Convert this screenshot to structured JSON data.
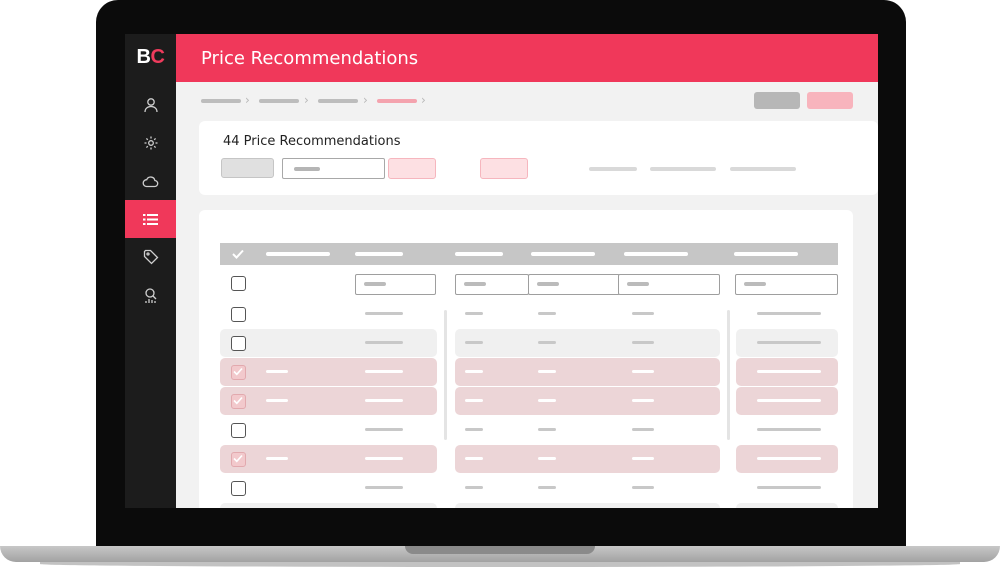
{
  "brand": {
    "logo_b": "B",
    "logo_c": "C",
    "accent": "#f0385a"
  },
  "header": {
    "title": "Price Recommendations"
  },
  "sidebar": {
    "items": [
      {
        "icon": "user-icon",
        "active": false
      },
      {
        "icon": "gear-icon",
        "active": false
      },
      {
        "icon": "cloud-icon",
        "active": false
      },
      {
        "icon": "list-icon",
        "active": true
      },
      {
        "icon": "tag-icon",
        "active": false
      },
      {
        "icon": "analytics-search-icon",
        "active": false
      }
    ]
  },
  "main": {
    "count_title": "44 Price Recommendations",
    "rows": [
      {
        "checked": false,
        "shade": "white"
      },
      {
        "checked": false,
        "shade": "gray"
      },
      {
        "checked": true,
        "shade": "pink"
      },
      {
        "checked": true,
        "shade": "pink"
      },
      {
        "checked": false,
        "shade": "white"
      },
      {
        "checked": true,
        "shade": "pink"
      },
      {
        "checked": false,
        "shade": "white"
      },
      {
        "checked": false,
        "shade": "gray"
      }
    ]
  }
}
